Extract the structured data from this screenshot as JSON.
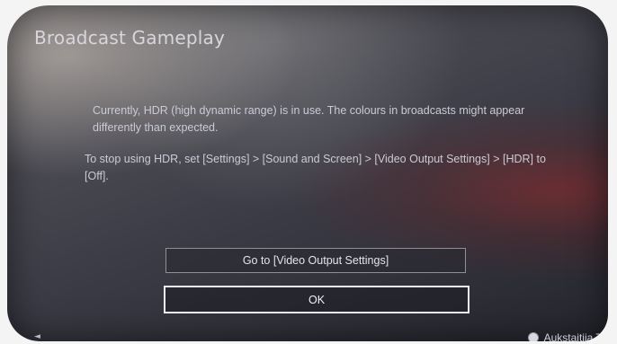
{
  "dialog": {
    "title": "Broadcast Gameplay",
    "message_1": "Currently, HDR (high dynamic range) is in use. The colours in broadcasts might appear differently than expected.",
    "message_2": "To stop using HDR, set [Settings] > [Sound and Screen] > [Video Output Settings] > [HDR] to [Off].",
    "buttons": {
      "video_output": "Go to [Video Output Settings]",
      "ok": "OK"
    }
  },
  "footer": {
    "user_name": "Aukstaitija Tre",
    "user_icon": "user-profile-icon"
  },
  "colors": {
    "screen_background": "#3a3b45",
    "text": "#c9cbd6",
    "focus_border": "#ececf2"
  }
}
